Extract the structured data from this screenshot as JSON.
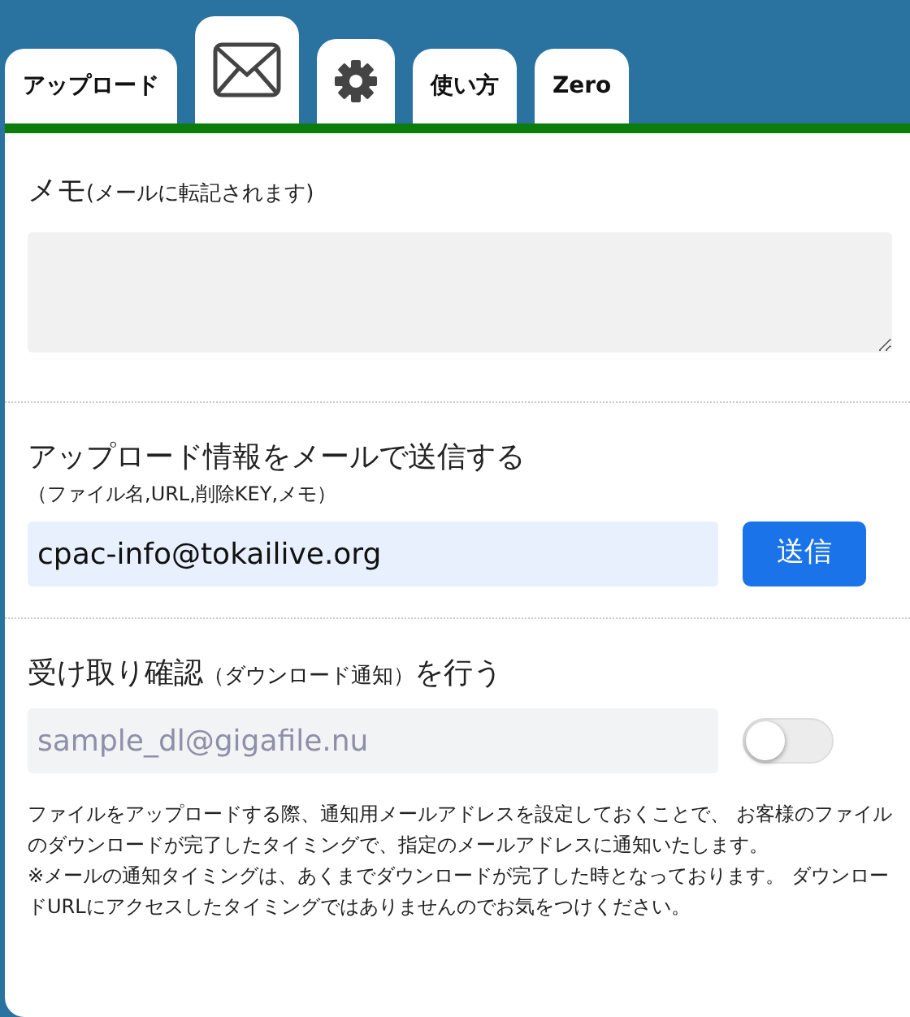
{
  "tabs": [
    {
      "kind": "text",
      "label": "アップロード",
      "selected": false
    },
    {
      "kind": "mail",
      "selected": true
    },
    {
      "kind": "gear",
      "selected": false
    },
    {
      "kind": "text",
      "label": "使い方",
      "selected": false
    },
    {
      "kind": "text",
      "label": "Zero",
      "selected": false
    }
  ],
  "memo": {
    "title": "メモ",
    "note": "(メールに転記されます)"
  },
  "send": {
    "title": "アップロード情報をメールで送信する",
    "note": "（ファイル名,URL,削除KEY,メモ）",
    "value": "cpac-info@tokailive.org",
    "button": "送信"
  },
  "receipt": {
    "title": "受け取り確認",
    "note": "（ダウンロード通知）",
    "title_end": "を行う",
    "placeholder": "sample_dl@gigafile.nu",
    "on": false
  },
  "notes": [
    "ファイルをアップロードする際、通知用メールアドレスを設定しておくことで、 お客様のファイルのダウンロードが完了したタイミングで、指定のメールアドレスに通知いたします。",
    "※メールの通知タイミングは、あくまでダウンロードが完了した時となっております。 ダウンロードURLにアクセスしたタイミングではありませんのでお気をつけください。"
  ]
}
